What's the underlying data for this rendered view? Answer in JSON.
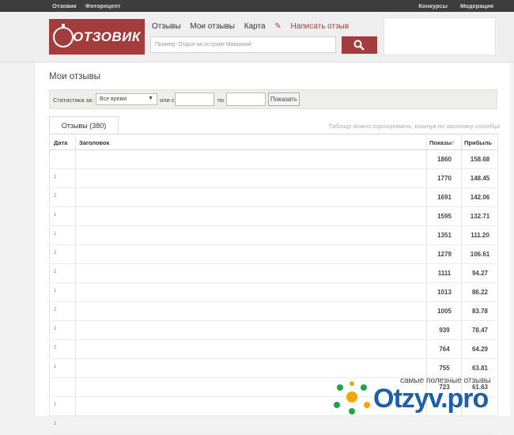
{
  "topbar": {
    "left": [
      "Отзовик",
      "Фоторецепт"
    ],
    "right": [
      "Конкурсы",
      "Модерация"
    ]
  },
  "header": {
    "logo": "ОТЗОВИК",
    "nav": [
      "Отзывы",
      "Мои отзывы",
      "Карта"
    ],
    "write": "Написать отзыв",
    "search_placeholder": "Пример: Отдых на острове Маврикий"
  },
  "page": {
    "title": "Мои отзывы"
  },
  "filter": {
    "label_stats": "Статистика за:",
    "period": "Все время",
    "label_from": "или с",
    "label_to": "по",
    "button": "Показать"
  },
  "tab": {
    "label": "Отзывы (380)"
  },
  "hint": "Таблицу можно сортировать, кликнув по заголовку столбца",
  "table": {
    "headers": {
      "date": "Дата",
      "title": "Заголовок",
      "views": "Показы↑",
      "profit": "Прибыль"
    },
    "rows": [
      {
        "d": "·",
        "views": "1860",
        "profit": "158.68"
      },
      {
        "d": "1",
        "views": "1770",
        "profit": "148.45"
      },
      {
        "d": "2",
        "views": "1691",
        "profit": "142.06"
      },
      {
        "d": "1",
        "views": "1595",
        "profit": "132.71"
      },
      {
        "d": "1",
        "views": "1351",
        "profit": "111.20"
      },
      {
        "d": "2",
        "views": "1279",
        "profit": "106.61"
      },
      {
        "d": "2",
        "views": "1111",
        "profit": "94.27"
      },
      {
        "d": "1",
        "views": "1013",
        "profit": "86.22"
      },
      {
        "d": "2",
        "views": "1005",
        "profit": "83.78"
      },
      {
        "d": "2",
        "views": "939",
        "profit": "78.47"
      },
      {
        "d": "2",
        "views": "764",
        "profit": "64.29"
      },
      {
        "d": "1",
        "views": "755",
        "profit": "63.81"
      },
      {
        "d": "",
        "views": "723",
        "profit": "61.63"
      },
      {
        "d": "1",
        "views": "",
        "profit": ""
      },
      {
        "d": "1",
        "views": "",
        "profit": ""
      }
    ]
  },
  "watermark": {
    "slogan": "самые полезные отзывы",
    "brand": "Otzyv.pro"
  },
  "colors": {
    "brand": "#a33d3b",
    "watermark": "#1e5fa8"
  }
}
